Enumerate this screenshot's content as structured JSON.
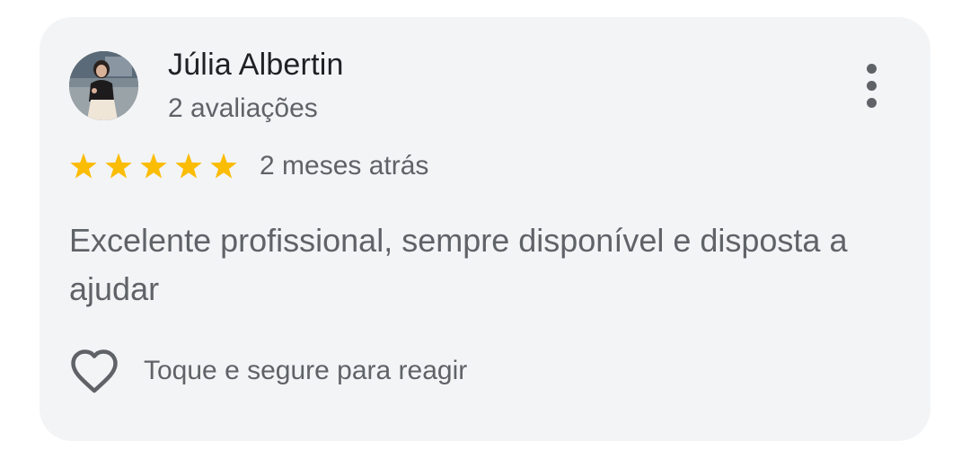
{
  "review": {
    "author_name": "Júlia Albertin",
    "author_review_count": "2 avaliações",
    "avatar": "profile-photo",
    "rating": 5,
    "rating_max": 5,
    "time_ago": "2 meses atrás",
    "text": "Excelente profissional, sempre disponível e disposta a ajudar",
    "react_label": "Toque e segure para reagir",
    "icons": {
      "menu": "more-vertical-icon",
      "star": "star-icon",
      "react": "heart-outline-icon"
    }
  },
  "colors": {
    "card_background": "#f3f4f6",
    "star": "#fbbc04",
    "primary_text": "#202124",
    "secondary_text": "#5f6368"
  }
}
